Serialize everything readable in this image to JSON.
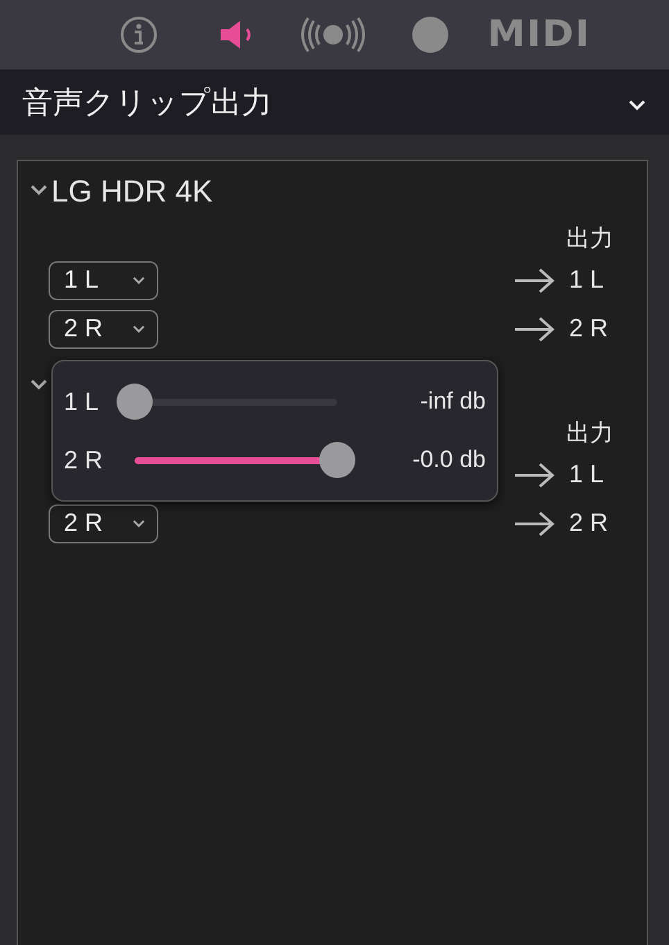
{
  "toolbar": {
    "tabs": [
      {
        "kind": "info",
        "selected": false
      },
      {
        "kind": "speaker",
        "selected": true
      },
      {
        "kind": "broadcast",
        "selected": false
      },
      {
        "kind": "record",
        "selected": false
      },
      {
        "kind": "midi",
        "label": "MIDI",
        "selected": false
      }
    ]
  },
  "section": {
    "title": "音声クリップ出力",
    "expanded": true
  },
  "devices": [
    {
      "name": "LG HDR 4K",
      "expanded": true,
      "output_heading": "出力",
      "rows": [
        {
          "input": "1 L",
          "output": "1 L"
        },
        {
          "input": "2 R",
          "output": "2 R"
        }
      ]
    },
    {
      "expanded": true,
      "output_heading": "出力",
      "rows": [
        {
          "output": "1 L"
        },
        {
          "input": "2 R",
          "output": "2 R"
        }
      ]
    }
  ],
  "popup": {
    "channels": [
      {
        "label": "1 L",
        "level": 0,
        "reading": "-inf db"
      },
      {
        "label": "2 R",
        "level": 1,
        "reading": "-0.0 db"
      }
    ]
  }
}
